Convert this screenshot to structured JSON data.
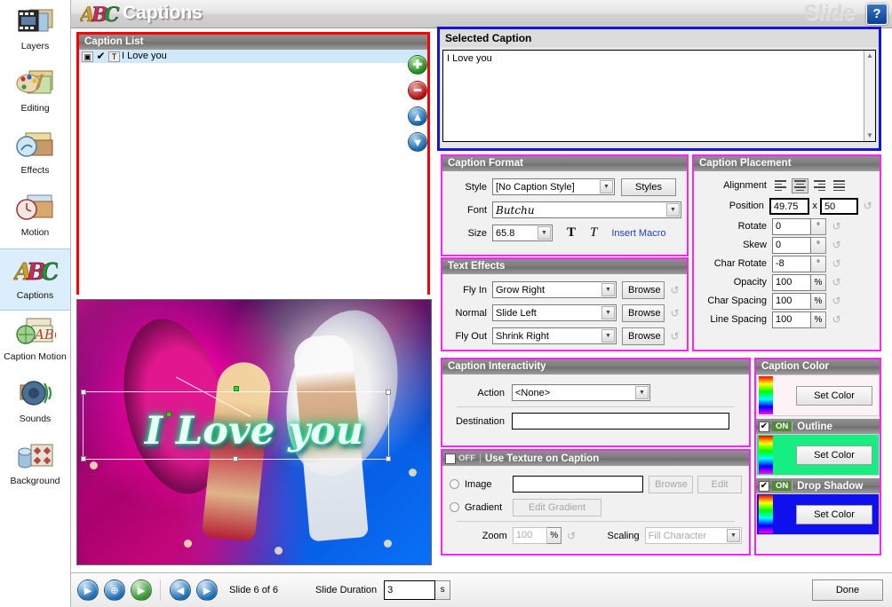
{
  "header": {
    "title": "Captions",
    "watermark": "Slide",
    "help_label": "?",
    "logo_icon": "abc-captions-logo-icon"
  },
  "sidebar": {
    "items": [
      {
        "label": "Layers",
        "icon": "layers-icon",
        "active": false
      },
      {
        "label": "Editing",
        "icon": "editing-palette-icon",
        "active": false
      },
      {
        "label": "Effects",
        "icon": "effects-icon",
        "active": false
      },
      {
        "label": "Motion",
        "icon": "motion-clock-icon",
        "active": false
      },
      {
        "label": "Captions",
        "icon": "abc-captions-icon",
        "active": true
      },
      {
        "label": "Caption Motion",
        "icon": "caption-motion-icon",
        "active": false
      },
      {
        "label": "Sounds",
        "icon": "speaker-sounds-icon",
        "active": false
      },
      {
        "label": "Background",
        "icon": "background-icon",
        "active": false
      }
    ]
  },
  "caption_list": {
    "title": "Caption List",
    "border_color": "#ff0000",
    "rows": [
      {
        "text": "I Love you",
        "checked": "✔",
        "type_icon": "T",
        "slide_icon": "▣",
        "selected": true
      }
    ],
    "buttons": [
      {
        "name": "add-caption-button",
        "glyph": "✚",
        "style": "rb-green"
      },
      {
        "name": "remove-caption-button",
        "glyph": "━",
        "style": "rb-red"
      },
      {
        "name": "move-caption-up-button",
        "glyph": "▲",
        "style": "rb-blue"
      },
      {
        "name": "move-caption-down-button",
        "glyph": "▼",
        "style": "rb-blue"
      }
    ]
  },
  "selected_caption": {
    "title": "Selected Caption",
    "text": "I Love you",
    "border_color": "#1414dd"
  },
  "preview": {
    "caption_text": "I Love you",
    "outline_glow": "#39ffae"
  },
  "caption_format": {
    "title": "Caption Format",
    "style_label": "Style",
    "style_value": "[No Caption Style]",
    "styles_button": "Styles",
    "font_label": "Font",
    "font_value": "Butchu",
    "size_label": "Size",
    "size_value": "65.8",
    "bold_button": "T",
    "italic_button": "T",
    "insert_macro": "Insert Macro"
  },
  "text_effects": {
    "title": "Text Effects",
    "rows": [
      {
        "label": "Fly In",
        "value": "Grow Right",
        "browse": "Browse"
      },
      {
        "label": "Normal",
        "value": "Slide Left",
        "browse": "Browse"
      },
      {
        "label": "Fly Out",
        "value": "Shrink Right",
        "browse": "Browse"
      }
    ]
  },
  "caption_placement": {
    "title": "Caption Placement",
    "alignment_label": "Alignment",
    "alignment_options": [
      "left",
      "center",
      "right",
      "justify"
    ],
    "alignment_selected": 1,
    "position_label": "Position",
    "position_x": "49.75",
    "position_sep": "x",
    "position_y": "50",
    "fields": [
      {
        "label": "Rotate",
        "value": "0",
        "unit": "°"
      },
      {
        "label": "Skew",
        "value": "0",
        "unit": "°"
      },
      {
        "label": "Char Rotate",
        "value": "-8",
        "unit": "°"
      },
      {
        "label": "Opacity",
        "value": "100",
        "unit": "%"
      },
      {
        "label": "Char Spacing",
        "value": "100",
        "unit": "%"
      },
      {
        "label": "Line Spacing",
        "value": "100",
        "unit": "%"
      }
    ]
  },
  "caption_interactivity": {
    "title": "Caption Interactivity",
    "action_label": "Action",
    "action_value": "<None>",
    "destination_label": "Destination",
    "destination_value": ""
  },
  "use_texture": {
    "title": "Use Texture on Caption",
    "state": "OFF",
    "image_label": "Image",
    "image_value": "",
    "browse_button": "Browse",
    "edit_button": "Edit",
    "gradient_label": "Gradient",
    "edit_gradient_button": "Edit Gradient",
    "zoom_label": "Zoom",
    "zoom_value": "100",
    "zoom_unit": "%",
    "scaling_label": "Scaling",
    "scaling_value": "Fill Character"
  },
  "caption_color": {
    "title": "Caption Color",
    "set_color_button": "Set Color",
    "blocks": [
      {
        "name": "caption-color",
        "title": "Caption Color",
        "has_toggle": false,
        "state": "",
        "swatch": "#fdf3f6"
      },
      {
        "name": "outline",
        "title": "Outline",
        "has_toggle": true,
        "state": "ON",
        "swatch": "#17ee82"
      },
      {
        "name": "drop-shadow",
        "title": "Drop Shadow",
        "has_toggle": true,
        "state": "ON",
        "swatch": "#1010ee"
      }
    ]
  },
  "bottombar": {
    "tools": [
      {
        "name": "preview-slide-button",
        "glyph": "▶",
        "style": "gb-blue"
      },
      {
        "name": "zoom-slide-button",
        "glyph": "⊕",
        "style": "gb-blue"
      },
      {
        "name": "play-slideshow-button",
        "glyph": "▶",
        "style": "gb-green"
      }
    ],
    "prev_button": "◀",
    "next_button": "▶",
    "slide_counter": "Slide 6 of 6",
    "duration_label": "Slide Duration",
    "duration_value": "3",
    "duration_unit": "s",
    "done_button": "Done"
  }
}
